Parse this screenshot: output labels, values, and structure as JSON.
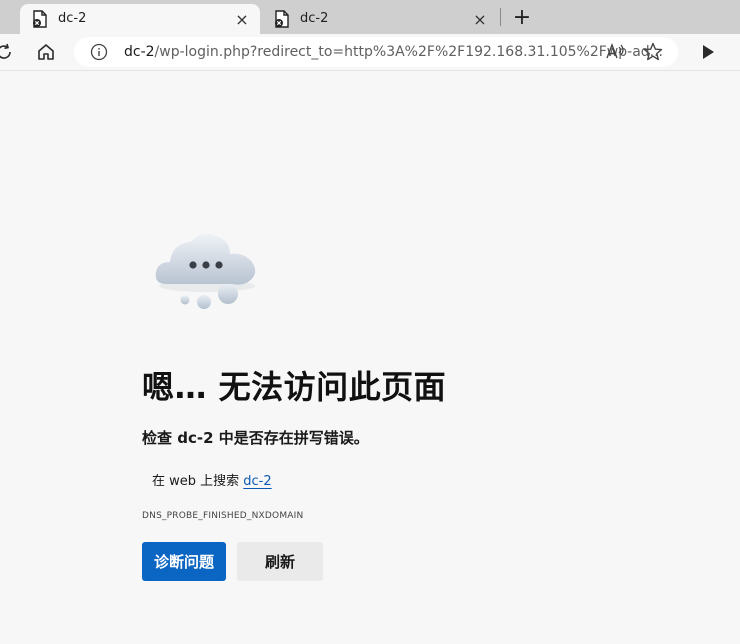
{
  "tabs": [
    {
      "label": "dc-2",
      "active": true
    },
    {
      "label": "dc-2",
      "active": false
    }
  ],
  "tab_close_glyph": "×",
  "new_tab_glyph": "+",
  "address": {
    "host": "dc-2",
    "path": "/wp-login.php?redirect_to=http%3A%2F%2F192.168.31.105%2Fwp-ad..."
  },
  "error": {
    "title": "嗯… 无法访问此页面",
    "subtitle": "检查 dc-2 中是否存在拼写错误。",
    "search_prefix": "在 web 上搜索 ",
    "search_link": "dc-2",
    "code": "DNS_PROBE_FINISHED_NXDOMAIN"
  },
  "buttons": {
    "diagnose": "诊断问题",
    "refresh": "刷新"
  },
  "icons": {
    "tab_favicon": "broken-page-icon",
    "refresh": "refresh-icon",
    "home": "home-icon",
    "info": "info-icon",
    "read_aloud": "read-aloud-icon",
    "favorite": "star-icon",
    "forward": "play-icon",
    "illustration": "cloud-icon"
  },
  "colors": {
    "primary_button": "#0b65c2",
    "link": "#0a59b5"
  }
}
